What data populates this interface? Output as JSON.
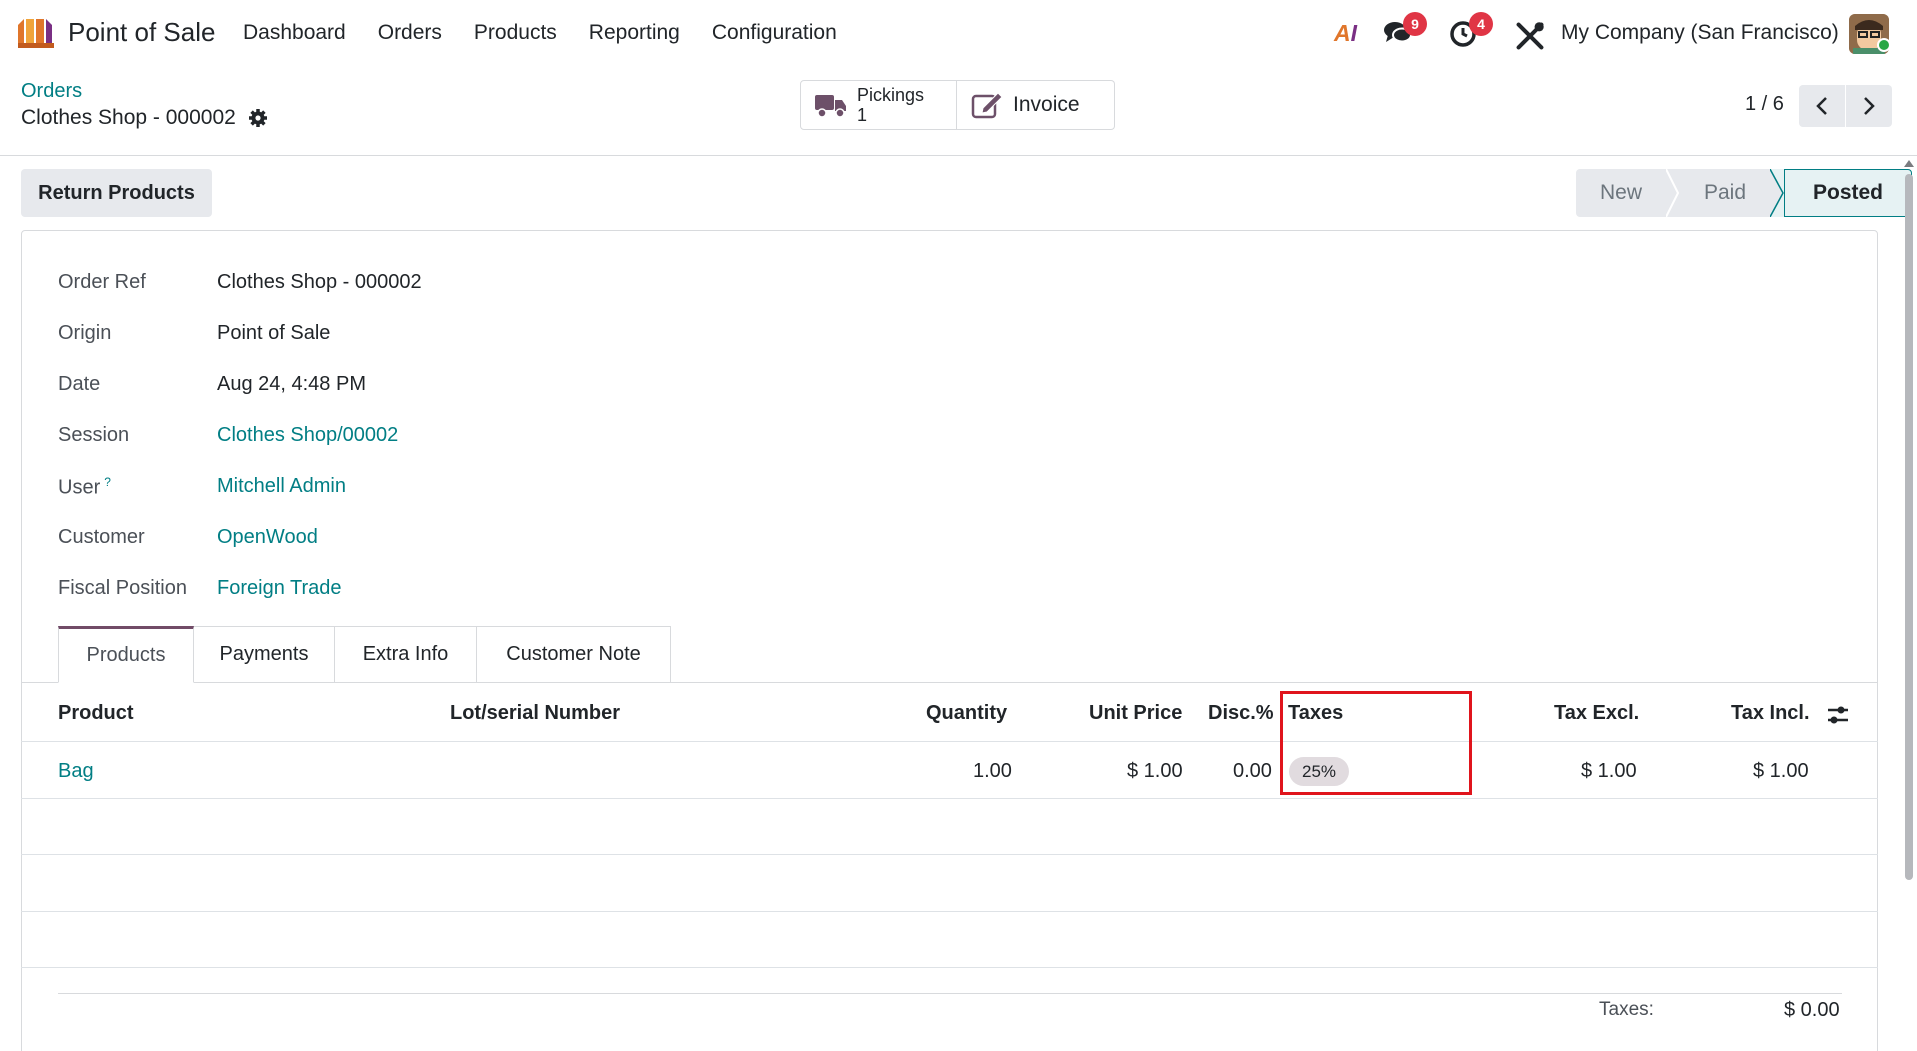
{
  "topnav": {
    "app_name": "Point of Sale",
    "menu": [
      "Dashboard",
      "Orders",
      "Products",
      "Reporting",
      "Configuration"
    ],
    "ai_label_a": "A",
    "ai_label_i": "I",
    "messages_count": "9",
    "activities_count": "4",
    "company": "My Company (San Francisco)"
  },
  "control_panel": {
    "breadcrumb": "Orders",
    "record_name": "Clothes Shop - 000002",
    "smart_buttons": {
      "pickings_label": "Pickings",
      "pickings_count": "1",
      "invoice_label": "Invoice"
    },
    "pager": "1 / 6"
  },
  "actions": {
    "return_products": "Return Products"
  },
  "statusbar": {
    "stages": [
      "New",
      "Paid",
      "Posted"
    ],
    "current": "Posted"
  },
  "form": {
    "fields": [
      {
        "label": "Order Ref",
        "value": "Clothes Shop - 000002"
      },
      {
        "label": "Origin",
        "value": "Point of Sale"
      },
      {
        "label": "Date",
        "value": "Aug 24, 4:48 PM"
      },
      {
        "label": "Session",
        "value": "Clothes Shop/00002"
      },
      {
        "label": "User",
        "value": "Mitchell Admin"
      },
      {
        "label": "Customer",
        "value": "OpenWood"
      },
      {
        "label": "Fiscal Position",
        "value": "Foreign Trade"
      }
    ],
    "help_mark": "?"
  },
  "tabs": [
    "Products",
    "Payments",
    "Extra Info",
    "Customer Note"
  ],
  "table": {
    "headers": {
      "product": "Product",
      "lot": "Lot/serial Number",
      "quantity": "Quantity",
      "unit_price": "Unit Price",
      "discount": "Disc.%",
      "taxes": "Taxes",
      "tax_excl": "Tax Excl.",
      "tax_incl": "Tax Incl."
    },
    "rows": [
      {
        "product": "Bag",
        "lot": "",
        "quantity": "1.00",
        "unit_price": "$ 1.00",
        "discount": "0.00",
        "taxes": "25%",
        "tax_excl": "$ 1.00",
        "tax_incl": "$ 1.00"
      }
    ]
  },
  "totals": {
    "taxes_label": "Taxes:",
    "taxes_value": "$ 0.00"
  },
  "colors": {
    "accent": "#017e84",
    "brand": "#714b67",
    "highlight": "#e0141c",
    "badge": "#e03545"
  }
}
